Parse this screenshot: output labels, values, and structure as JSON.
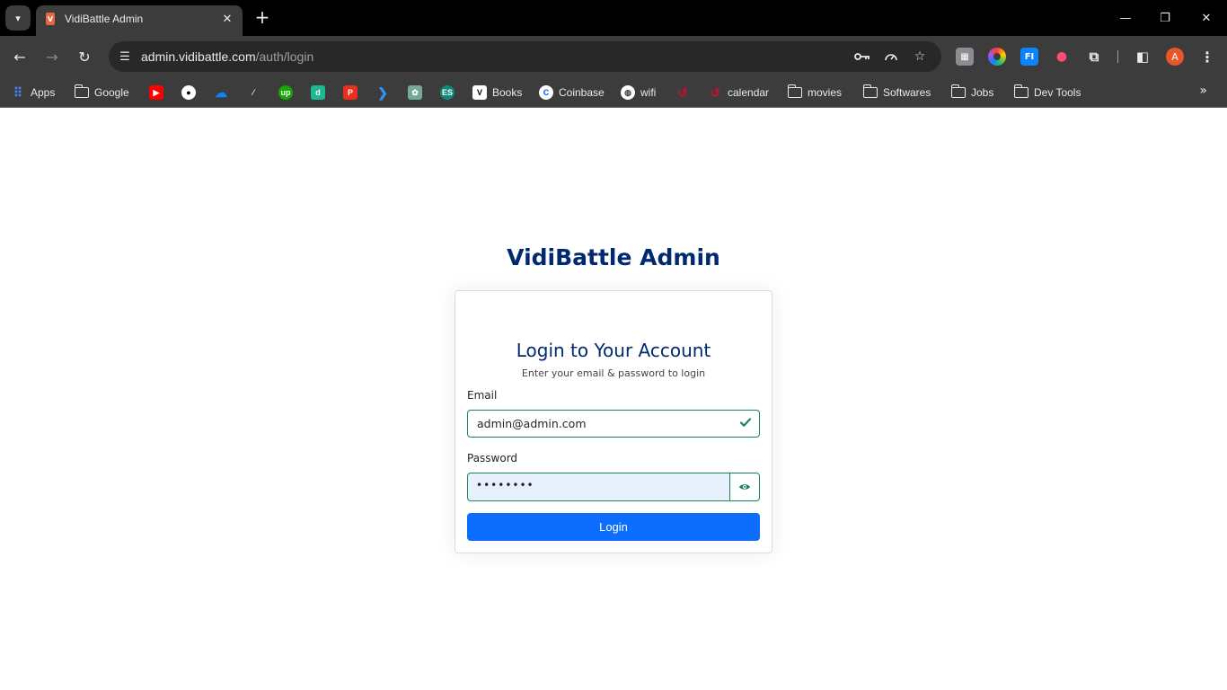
{
  "browser": {
    "tab": {
      "title": "VidiBattle Admin",
      "favicon": "vidibattle-favicon"
    },
    "url": {
      "host": "admin.vidibattle.com",
      "path": "/auth/login"
    },
    "avatar_letter": "A",
    "bookmarks": [
      {
        "label": "Apps",
        "icon": "apps-grid-icon"
      },
      {
        "label": "Google",
        "icon": "folder-icon"
      },
      {
        "label": "",
        "icon": "youtube-icon"
      },
      {
        "label": "",
        "icon": "github-icon"
      },
      {
        "label": "",
        "icon": "onedrive-icon"
      },
      {
        "label": "",
        "icon": "feather-icon"
      },
      {
        "label": "",
        "icon": "upwork-icon"
      },
      {
        "label": "",
        "icon": "d-icon"
      },
      {
        "label": "",
        "icon": "p-icon"
      },
      {
        "label": "",
        "icon": "vscode-icon"
      },
      {
        "label": "",
        "icon": "chatgpt-icon"
      },
      {
        "label": "",
        "icon": "es-icon"
      },
      {
        "label": "Books",
        "icon": "v-icon"
      },
      {
        "label": "Coinbase",
        "icon": "coinbase-icon"
      },
      {
        "label": "wifi",
        "icon": "globe-icon"
      },
      {
        "label": "",
        "icon": "red-swirl-icon"
      },
      {
        "label": "calendar",
        "icon": "red-swirl-icon"
      },
      {
        "label": "movies",
        "icon": "folder-icon"
      },
      {
        "label": "Softwares",
        "icon": "folder-icon"
      },
      {
        "label": "Jobs",
        "icon": "folder-icon"
      },
      {
        "label": "Dev Tools",
        "icon": "folder-icon"
      }
    ]
  },
  "page": {
    "brand": "VidiBattle Admin",
    "card_title": "Login to Your Account",
    "card_subtitle": "Enter your email & password to login",
    "email_label": "Email",
    "email_value": "admin@admin.com",
    "password_label": "Password",
    "password_value": "••••••••",
    "login_button": "Login",
    "colors": {
      "brand": "#012970",
      "primary": "#0d6efd",
      "valid": "#198754",
      "autofill": "#e8f0fe"
    }
  }
}
